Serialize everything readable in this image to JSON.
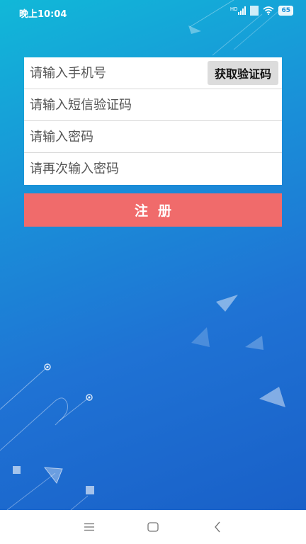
{
  "status_bar": {
    "time": "晚上10:04",
    "signal_label": "HD",
    "battery_level": "65"
  },
  "form": {
    "phone_placeholder": "请输入手机号",
    "get_code_label": "获取验证码",
    "sms_code_placeholder": "请输入短信验证码",
    "password_placeholder": "请输入密码",
    "confirm_password_placeholder": "请再次输入密码",
    "register_label": "注册"
  },
  "nav_bar": {
    "menu_icon": "menu-icon",
    "home_icon": "home-icon",
    "back_icon": "back-icon"
  },
  "colors": {
    "background_top": "#11b8d8",
    "background_bottom": "#1960c8",
    "register_button": "#f06b6b",
    "code_button": "#dcdcdc"
  }
}
